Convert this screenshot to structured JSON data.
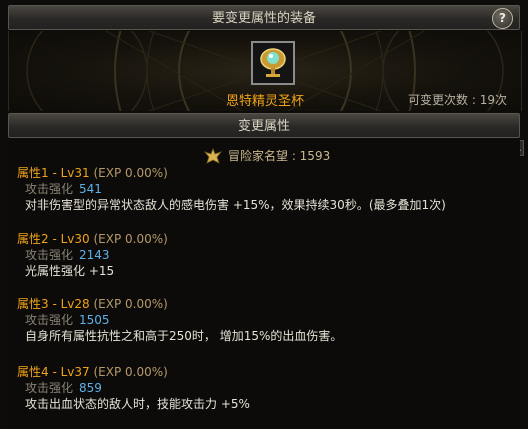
{
  "window": {
    "title": "要变更属性的装备",
    "help_label": "?",
    "change_section_title": "变更属性"
  },
  "item": {
    "name": "恩特精灵圣杯",
    "remaining_changes": "可变更次数 : 19次",
    "icon": "grail-icon"
  },
  "reputation": {
    "label": "冒险家名望 : 1593",
    "icon": "crest-icon"
  },
  "properties": [
    {
      "header": "属性1 - Lv31",
      "exp": "(EXP 0.00%)",
      "stat_label": "攻击强化",
      "stat_value": "541",
      "desc": "对非伤害型的异常状态敌人的感电伤害 +15%，效果持续30秒。(最多叠加1次)"
    },
    {
      "header": "属性2 - Lv30",
      "exp": "(EXP 0.00%)",
      "stat_label": "攻击强化",
      "stat_value": "2143",
      "desc": "光属性强化 +15"
    },
    {
      "header": "属性3 - Lv28",
      "exp": "(EXP 0.00%)",
      "stat_label": "攻击强化",
      "stat_value": "1505",
      "desc": "自身所有属性抗性之和高于250时， 增加15%的出血伤害。"
    },
    {
      "header": "属性4 - Lv37",
      "exp": "(EXP 0.00%)",
      "stat_label": "攻击强化",
      "stat_value": "859",
      "desc": "攻击出血状态的敌人时，技能攻击力 +5%"
    }
  ],
  "colors": {
    "accent_orange": "#f0a317",
    "stat_blue": "#5fb0e8",
    "panel_bg": "#0c0b09"
  }
}
